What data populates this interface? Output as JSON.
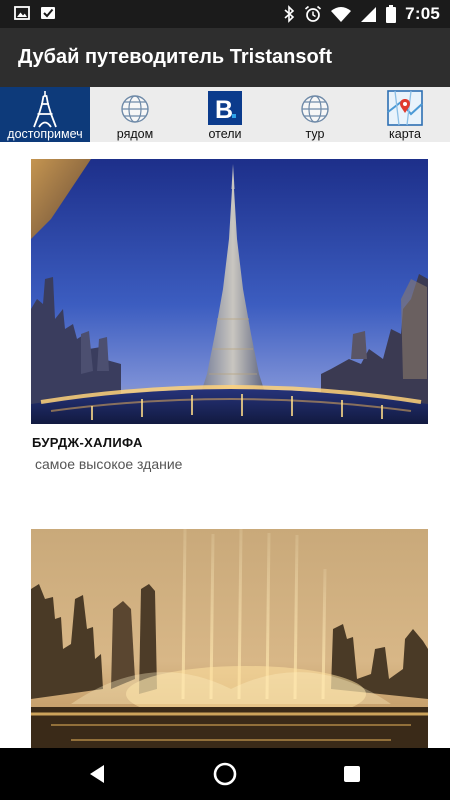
{
  "status_bar": {
    "time": "7:05",
    "left_icons": [
      "image-icon",
      "mail-check-icon"
    ],
    "right_icons": [
      "bluetooth-icon",
      "alarm-icon",
      "wifi-icon",
      "signal-icon",
      "battery-icon"
    ]
  },
  "app_bar": {
    "title": "Дубай путеводитель Tristansoft"
  },
  "tabs": [
    {
      "label": "достопримеч",
      "icon": "eiffel-tower-icon",
      "active": true
    },
    {
      "label": "рядом",
      "icon": "globe-icon",
      "active": false
    },
    {
      "label": "отели",
      "icon": "booking-b-icon",
      "active": false
    },
    {
      "label": "тур",
      "icon": "globe-icon",
      "active": false
    },
    {
      "label": "карта",
      "icon": "map-pin-icon",
      "active": false
    }
  ],
  "cards": [
    {
      "title": "БУРДЖ-ХАЛИФА",
      "subtitle": "самое высокое здание",
      "image": "burj-khalifa-photo"
    },
    {
      "title": "",
      "subtitle": "",
      "image": "dubai-fountain-photo"
    }
  ],
  "nav_bar": {
    "buttons": [
      "back-button",
      "home-button",
      "recents-button"
    ]
  },
  "colors": {
    "status_bar_bg": "#1b1b1b",
    "app_bar_bg": "#2e2e2e",
    "tab_strip_bg": "#ececec",
    "active_tab_bg": "#0d3a7a",
    "booking_blue": "#0b3b8c"
  }
}
